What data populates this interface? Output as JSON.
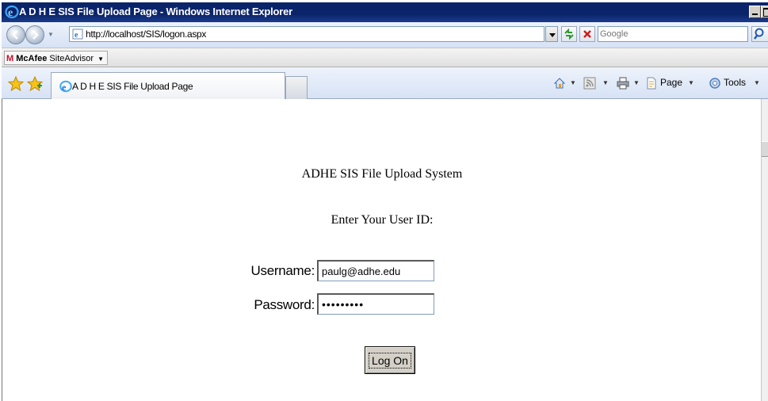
{
  "window": {
    "title": "A D H E SIS File Upload Page - Windows Internet Explorer"
  },
  "address_bar": {
    "url": "http://localhost/SIS/logon.aspx"
  },
  "search": {
    "placeholder": "Google"
  },
  "toolbar": {
    "mcafee_brand": "McAfee",
    "mcafee_product": "SiteAdvisor",
    "page_label": "Page",
    "tools_label": "Tools"
  },
  "tab": {
    "title": "A D H E SIS File Upload Page"
  },
  "page": {
    "heading": "ADHE SIS File Upload System",
    "subheading": "Enter Your User ID:",
    "username_label": "Username:",
    "username_value": "paulg@adhe.edu",
    "password_label": "Password:",
    "password_value": "•••••••••",
    "logon_label": "Log On"
  },
  "colors": {
    "titlebar": "#0a246a",
    "chrome": "#d6e2f5",
    "button_face": "#d4d0c8"
  }
}
